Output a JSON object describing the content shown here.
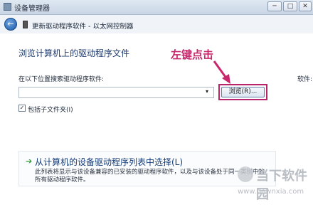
{
  "window": {
    "title": "设备管理器",
    "controls": {
      "minimize": "─",
      "maximize": "□",
      "close": "✕"
    }
  },
  "nav": {
    "back_icon": "←",
    "title": "更新驱动程序软件 - 以太网控制器"
  },
  "main": {
    "heading": "浏览计算机上的驱动程序文件",
    "search_label": "在以下位置搜索驱动程序软件:",
    "side_text": "软件:",
    "path_value": "",
    "dropdown_arrow": "▾",
    "browse_button": "浏览(R)...",
    "include_subfolders": {
      "checked": true,
      "mark": "✓",
      "label": "包括子文件夹(I)"
    }
  },
  "annotation": {
    "text": "左键点击",
    "color": "#c8276b"
  },
  "option": {
    "arrow": "➔",
    "title": "从计算机的设备驱动程序列表中选择(L)",
    "description": "此列表将显示与该设备兼容的已安装的驱动程序软件，以及与该设备处于同一类别中的所有驱动程序软件。"
  },
  "watermark": {
    "brand": "当下软件园",
    "url": "www.downxia.com"
  }
}
